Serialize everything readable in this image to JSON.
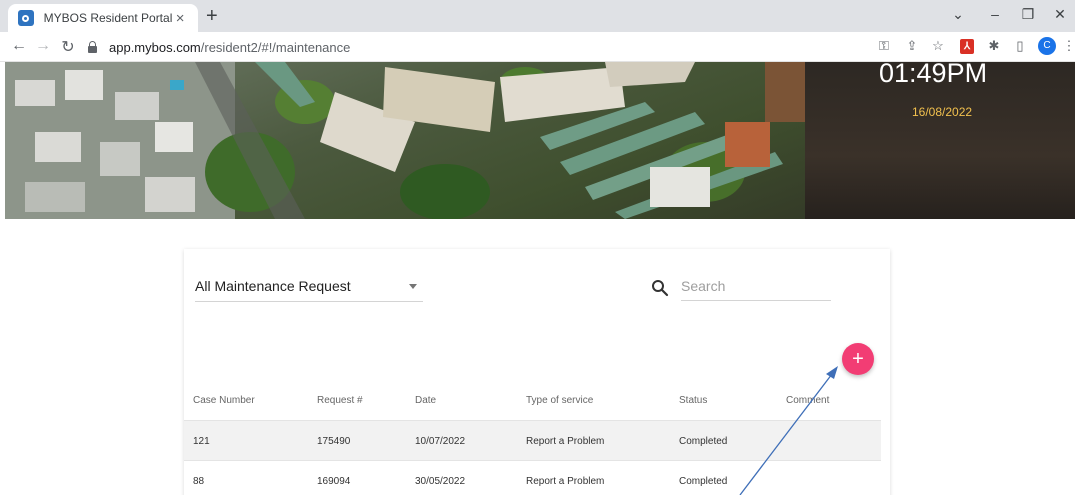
{
  "browser": {
    "tab_title": "MYBOS Resident Portal",
    "tab_close": "×",
    "new_tab": "+",
    "url_host": "app.mybos.com",
    "url_path": "/resident2/#!/maintenance",
    "avatar_letter": "C",
    "icons": [
      "back-icon",
      "forward-icon",
      "reload-icon",
      "lock-icon",
      "key-icon",
      "share-icon",
      "star-icon",
      "pdf-extension-icon",
      "extensions-icon",
      "sidepanel-icon",
      "avatar",
      "menu-icon"
    ]
  },
  "hero": {
    "time": "01:49PM",
    "date": "16/08/2022"
  },
  "filter": {
    "selected": "All Maintenance Request"
  },
  "search": {
    "placeholder": "Search"
  },
  "fab": {
    "label": "+"
  },
  "table": {
    "headers": [
      "Case Number",
      "Request #",
      "Date",
      "Type of service",
      "Status",
      "Comment"
    ],
    "rows": [
      [
        "121",
        "175490",
        "10/07/2022",
        "Report a Problem",
        "Completed",
        ""
      ],
      [
        "88",
        "169094",
        "30/05/2022",
        "Report a Problem",
        "Completed",
        ""
      ]
    ]
  },
  "colors": {
    "accent_fab": "#f23d74",
    "date_text": "#f2c14e",
    "annotation_arrow": "#3f6fb8"
  }
}
